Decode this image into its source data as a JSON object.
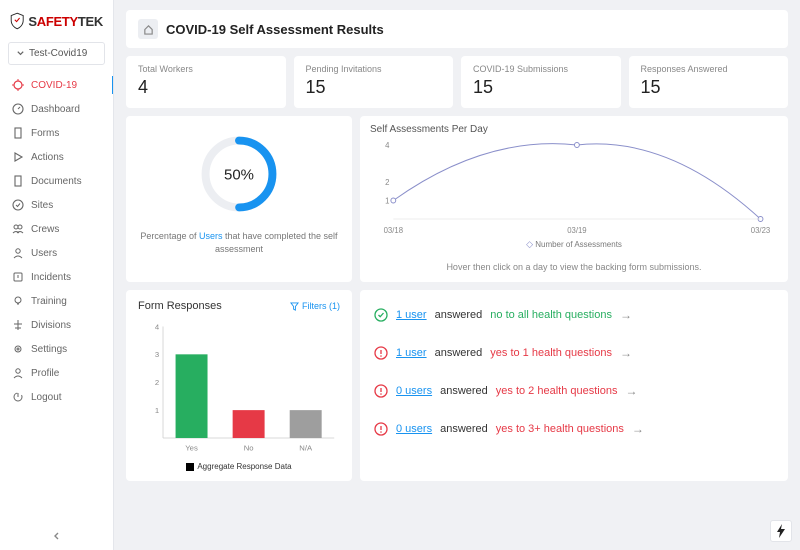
{
  "brand": {
    "pre": "S",
    "mid": "AFETY",
    "post": "TEK"
  },
  "project_selector": "Test-Covid19",
  "nav": [
    {
      "label": "COVID-19",
      "icon": "virus",
      "active": true
    },
    {
      "label": "Dashboard",
      "icon": "gauge"
    },
    {
      "label": "Forms",
      "icon": "doc"
    },
    {
      "label": "Actions",
      "icon": "play"
    },
    {
      "label": "Documents",
      "icon": "doc"
    },
    {
      "label": "Sites",
      "icon": "check"
    },
    {
      "label": "Crews",
      "icon": "users"
    },
    {
      "label": "Users",
      "icon": "user"
    },
    {
      "label": "Incidents",
      "icon": "alert"
    },
    {
      "label": "Training",
      "icon": "bulb"
    },
    {
      "label": "Divisions",
      "icon": "tree"
    },
    {
      "label": "Settings",
      "icon": "gear"
    },
    {
      "label": "Profile",
      "icon": "user"
    },
    {
      "label": "Logout",
      "icon": "power"
    }
  ],
  "page_title": "COVID-19 Self Assessment Results",
  "stats": [
    {
      "label": "Total Workers",
      "value": "4"
    },
    {
      "label": "Pending Invitations",
      "value": "15"
    },
    {
      "label": "COVID-19 Submissions",
      "value": "15"
    },
    {
      "label": "Responses Answered",
      "value": "15"
    }
  ],
  "gauge": {
    "percent_label": "50%",
    "caption_pre": "Percentage of ",
    "caption_link": "Users",
    "caption_post": " that have completed the self assessment"
  },
  "line_chart_title": "Self Assessments Per Day",
  "line_legend": "Number of Assessments",
  "line_hint": "Hover then click on a day to view the backing form submissions.",
  "bar_title": "Form Responses",
  "filters_label": "Filters (1)",
  "bar_legend": "Aggregate Response Data",
  "responses": [
    {
      "icon": "ok",
      "link": "1 user",
      "mid": " answered ",
      "tail": "no to all health questions",
      "tailClass": "green"
    },
    {
      "icon": "warn",
      "link": "1 user",
      "mid": " answered ",
      "tail": "yes to 1 health questions",
      "tailClass": "red"
    },
    {
      "icon": "warn",
      "link": "0 users",
      "mid": " answered ",
      "tail": "yes to 2 health questions",
      "tailClass": "red"
    },
    {
      "icon": "warn",
      "link": "0 users",
      "mid": " answered ",
      "tail": "yes to 3+ health questions",
      "tailClass": "red"
    }
  ],
  "chart_data": [
    {
      "type": "line",
      "title": "Self Assessments Per Day",
      "series": [
        {
          "name": "Number of Assessments",
          "values": [
            1,
            4,
            0
          ]
        }
      ],
      "x": [
        "03/18",
        "03/19",
        "03/23"
      ],
      "ylim": [
        0,
        4
      ],
      "yticks": [
        1,
        2,
        4
      ]
    },
    {
      "type": "bar",
      "title": "Form Responses",
      "categories": [
        "Yes",
        "No",
        "N/A"
      ],
      "values": [
        3,
        1,
        1
      ],
      "colors": [
        "#27ae60",
        "#e63946",
        "#9e9e9e"
      ],
      "ylim": [
        0,
        4
      ],
      "yticks": [
        1,
        2,
        3,
        4
      ],
      "legend": "Aggregate Response Data"
    }
  ]
}
